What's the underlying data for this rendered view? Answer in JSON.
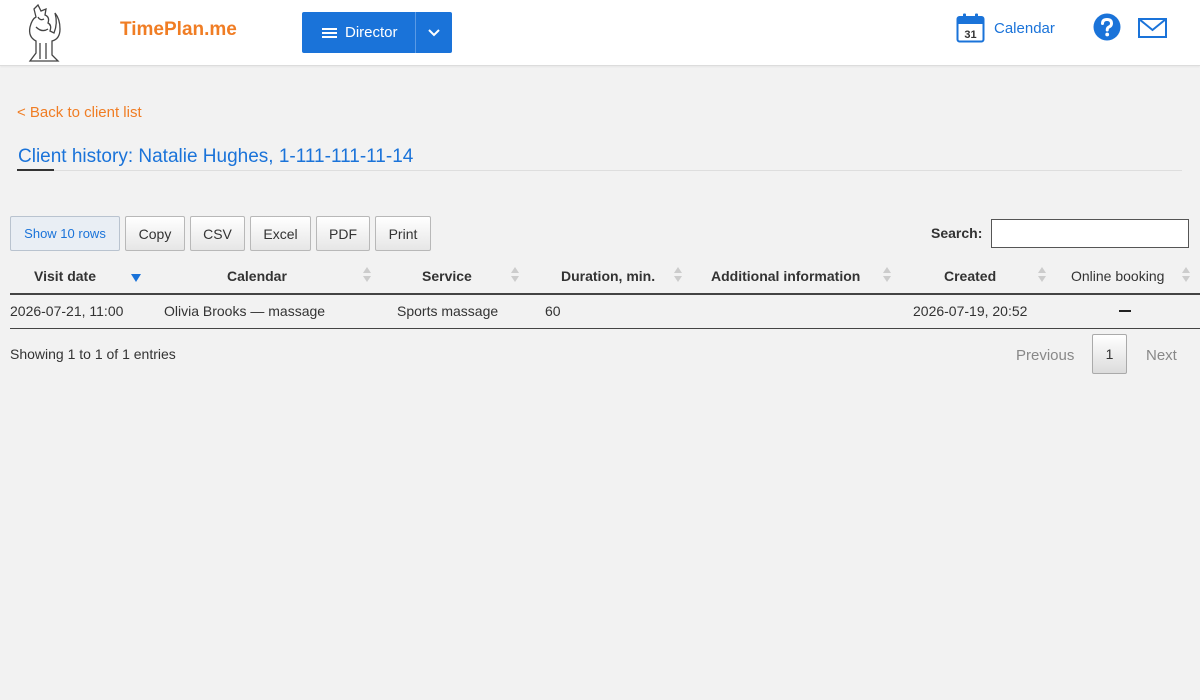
{
  "header": {
    "brand": "TimePlan.me",
    "role_label": "Director",
    "calendar_label": "Calendar",
    "calendar_icon_day": "31",
    "accent_color": "#1a73d9",
    "brand_color": "#f07d24"
  },
  "nav": {
    "back_link": "< Back to client list"
  },
  "page": {
    "title": "Client history: Natalie Hughes, 1-111-111-11-14"
  },
  "toolbar": {
    "buttons": [
      "Show 10 rows",
      "Copy",
      "CSV",
      "Excel",
      "PDF",
      "Print"
    ],
    "search_label": "Search:",
    "search_value": ""
  },
  "table": {
    "columns": [
      "Visit date",
      "Calendar",
      "Service",
      "Duration, min.",
      "Additional information",
      "Created",
      "Online booking"
    ],
    "rows": [
      {
        "visit_date": "2026-07-21, 11:00",
        "calendar": "Olivia Brooks — massage",
        "service": "Sports massage",
        "duration": "60",
        "additional_info": "",
        "created": "2026-07-19, 20:52",
        "online_booking": "dash-icon"
      }
    ]
  },
  "footer": {
    "info": "Showing 1 to 1 of 1 entries",
    "previous": "Previous",
    "current_page": "1",
    "next": "Next"
  }
}
